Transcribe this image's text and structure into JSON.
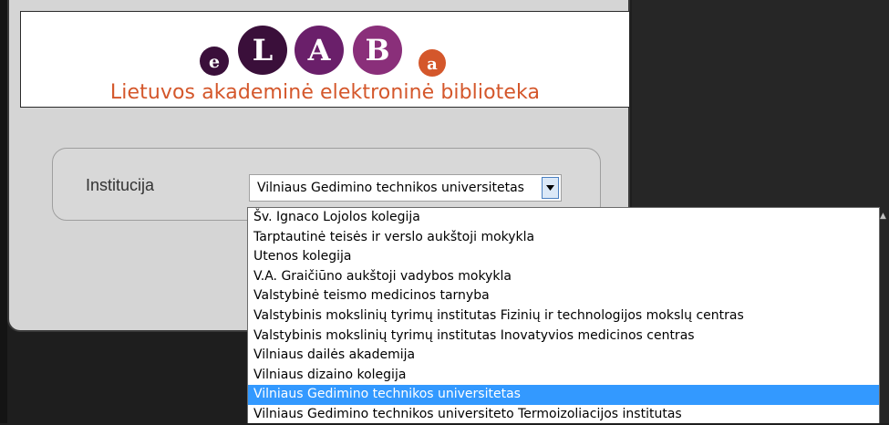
{
  "header": {
    "logo_letters": [
      "e",
      "L",
      "A",
      "B",
      "a"
    ],
    "subtitle": "Lietuvos akademinė elektroninė biblioteka",
    "colors": {
      "dark_circle": "#3a0f3a",
      "purple_circle": "#6a1f6a",
      "orange_circle": "#d4572b",
      "subtitle": "#d4572b"
    }
  },
  "form": {
    "institution_label": "Institucija",
    "institution_value": "Vilniaus Gedimino technikos universitetas",
    "dropdown_icon": "chevron-down-icon"
  },
  "dropdown": {
    "options": [
      "Šv. Ignaco Lojolos kolegija",
      "Tarptautinė teisės ir verslo aukštoji mokykla",
      "Utenos kolegija",
      "V.A. Graičiūno aukštoji vadybos mokykla",
      "Valstybinė teismo medicinos tarnyba",
      "Valstybinis mokslinių tyrimų institutas Fizinių ir technologijos mokslų centras",
      "Valstybinis mokslinių tyrimų institutas Inovatyvios medicinos centras",
      "Vilniaus dailės akademija",
      "Vilniaus dizaino kolegija",
      "Vilniaus Gedimino technikos universitetas",
      "Vilniaus Gedimino technikos universiteto Termoizoliacijos institutas"
    ],
    "selected_index": 9,
    "selected_color": "#3399ff"
  }
}
